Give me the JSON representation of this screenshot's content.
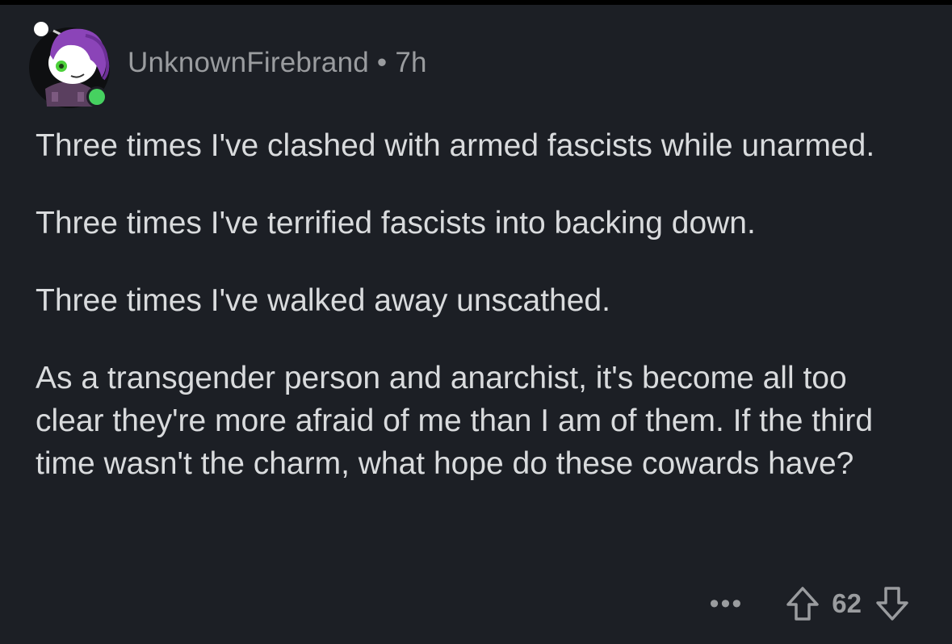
{
  "comment": {
    "author": "UnknownFirebrand",
    "separator": "•",
    "time": "7h",
    "online_status_color": "#46d160",
    "paragraphs": [
      "Three times I've clashed with armed fascists while unarmed.",
      "Three times I've terrified fascists into backing down.",
      "Three times I've walked away unscathed.",
      "As a transgender person and anarchist, it's become all too clear they're more afraid of me than I am of them. If the third time wasn't the charm, what hope do these cowards have?"
    ],
    "actions": {
      "more_label": "•••",
      "score": "62",
      "upvote_icon": "arrow-up-icon",
      "downvote_icon": "arrow-down-icon"
    }
  }
}
